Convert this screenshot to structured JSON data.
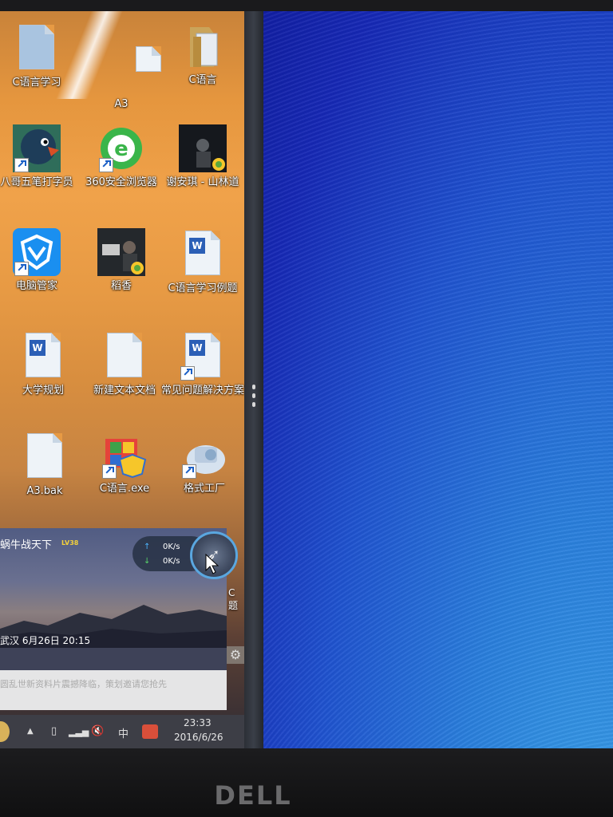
{
  "desktop": {
    "icons": [
      {
        "label": "C语言学习",
        "icon": "document-icon",
        "shortcut": false
      },
      {
        "label": "A3",
        "icon": "document-icon",
        "shortcut": false
      },
      {
        "label": "C语言",
        "icon": "folder-icon",
        "shortcut": false
      },
      {
        "label": "八哥五笔打字员",
        "icon": "parrot-app-icon",
        "shortcut": true
      },
      {
        "label": "360安全浏览器",
        "icon": "browser-icon",
        "shortcut": true
      },
      {
        "label": "谢安琪 - 山林道",
        "icon": "music-file-icon",
        "shortcut": false
      },
      {
        "label": "电脑管家",
        "icon": "shield-app-icon",
        "shortcut": true
      },
      {
        "label": "稻香",
        "icon": "music-file-icon",
        "shortcut": false
      },
      {
        "label": "C语言学习例题",
        "icon": "word-document-icon",
        "shortcut": false
      },
      {
        "label": "大学规划",
        "icon": "word-document-icon",
        "shortcut": false
      },
      {
        "label": "新建文本文档",
        "icon": "text-file-icon",
        "shortcut": false
      },
      {
        "label": "常见问题解决方案",
        "icon": "word-document-icon",
        "shortcut": true
      },
      {
        "label": "A3.bak",
        "icon": "file-icon",
        "shortcut": false
      },
      {
        "label": "C语言.exe",
        "icon": "exe-icon",
        "shortcut": true
      },
      {
        "label": "格式工厂",
        "icon": "format-factory-icon",
        "shortcut": true
      }
    ],
    "partial_label_right": "C题"
  },
  "popup": {
    "title": "蜗牛战天下",
    "level": "LV38",
    "location_date": "武汉  6月26日 20:15",
    "news": "圆乱世新资料片震撼降临，策划邀请您抢先"
  },
  "speed_widget": {
    "upload": "0K/s",
    "download": "0K/s"
  },
  "taskbar": {
    "ime": "中",
    "time": "23:33",
    "date": "2016/6/26"
  },
  "monitor": {
    "brand": "DELL"
  },
  "colors": {
    "wallpaper_left": "#e5963e",
    "wallpaper_right": "#1f52cf",
    "taskbar": "#3d3e46"
  }
}
